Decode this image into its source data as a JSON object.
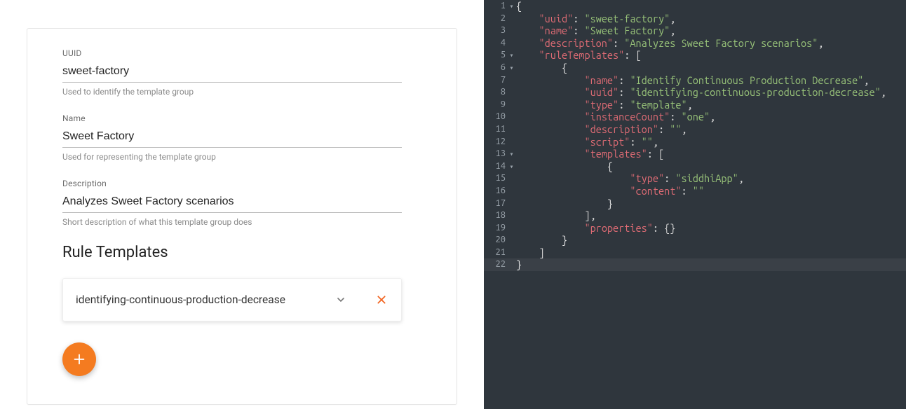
{
  "form": {
    "uuid": {
      "label": "UUID",
      "value": "sweet-factory",
      "help": "Used to identify the template group"
    },
    "name": {
      "label": "Name",
      "value": "Sweet Factory",
      "help": "Used for representing the template group"
    },
    "description": {
      "label": "Description",
      "value": "Analyzes Sweet Factory scenarios",
      "help": "Short description of what this template group does"
    }
  },
  "ruleTemplatesHeading": "Rule Templates",
  "ruleTemplates": [
    {
      "uuid": "identifying-continuous-production-decrease"
    }
  ],
  "code": {
    "lines": [
      {
        "n": 1,
        "fold": "▾",
        "tokens": [
          [
            "brace",
            "{"
          ]
        ]
      },
      {
        "n": 2,
        "fold": "",
        "indent": 4,
        "tokens": [
          [
            "key",
            "\"uuid\""
          ],
          [
            "punc",
            ": "
          ],
          [
            "str",
            "\"sweet-factory\""
          ],
          [
            "punc",
            ","
          ]
        ]
      },
      {
        "n": 3,
        "fold": "",
        "indent": 4,
        "tokens": [
          [
            "key",
            "\"name\""
          ],
          [
            "punc",
            ": "
          ],
          [
            "str",
            "\"Sweet Factory\""
          ],
          [
            "punc",
            ","
          ]
        ]
      },
      {
        "n": 4,
        "fold": "",
        "indent": 4,
        "tokens": [
          [
            "key",
            "\"description\""
          ],
          [
            "punc",
            ": "
          ],
          [
            "str",
            "\"Analyzes Sweet Factory scenarios\""
          ],
          [
            "punc",
            ","
          ]
        ]
      },
      {
        "n": 5,
        "fold": "▾",
        "indent": 4,
        "tokens": [
          [
            "key",
            "\"ruleTemplates\""
          ],
          [
            "punc",
            ": ["
          ]
        ]
      },
      {
        "n": 6,
        "fold": "▾",
        "indent": 8,
        "tokens": [
          [
            "brace",
            "{"
          ]
        ]
      },
      {
        "n": 7,
        "fold": "",
        "indent": 12,
        "tokens": [
          [
            "key",
            "\"name\""
          ],
          [
            "punc",
            ": "
          ],
          [
            "str",
            "\"Identify Continuous Production Decrease\""
          ],
          [
            "punc",
            ","
          ]
        ]
      },
      {
        "n": 8,
        "fold": "",
        "indent": 12,
        "tokens": [
          [
            "key",
            "\"uuid\""
          ],
          [
            "punc",
            ": "
          ],
          [
            "str",
            "\"identifying-continuous-production-decrease\""
          ],
          [
            "punc",
            ","
          ]
        ]
      },
      {
        "n": 9,
        "fold": "",
        "indent": 12,
        "tokens": [
          [
            "key",
            "\"type\""
          ],
          [
            "punc",
            ": "
          ],
          [
            "str",
            "\"template\""
          ],
          [
            "punc",
            ","
          ]
        ]
      },
      {
        "n": 10,
        "fold": "",
        "indent": 12,
        "tokens": [
          [
            "key",
            "\"instanceCount\""
          ],
          [
            "punc",
            ": "
          ],
          [
            "str",
            "\"one\""
          ],
          [
            "punc",
            ","
          ]
        ]
      },
      {
        "n": 11,
        "fold": "",
        "indent": 12,
        "tokens": [
          [
            "key",
            "\"description\""
          ],
          [
            "punc",
            ": "
          ],
          [
            "str",
            "\"\""
          ],
          [
            "punc",
            ","
          ]
        ]
      },
      {
        "n": 12,
        "fold": "",
        "indent": 12,
        "tokens": [
          [
            "key",
            "\"script\""
          ],
          [
            "punc",
            ": "
          ],
          [
            "str",
            "\"\""
          ],
          [
            "punc",
            ","
          ]
        ]
      },
      {
        "n": 13,
        "fold": "▾",
        "indent": 12,
        "tokens": [
          [
            "key",
            "\"templates\""
          ],
          [
            "punc",
            ": ["
          ]
        ]
      },
      {
        "n": 14,
        "fold": "▾",
        "indent": 16,
        "tokens": [
          [
            "brace",
            "{"
          ]
        ]
      },
      {
        "n": 15,
        "fold": "",
        "indent": 20,
        "tokens": [
          [
            "key",
            "\"type\""
          ],
          [
            "punc",
            ": "
          ],
          [
            "str",
            "\"siddhiApp\""
          ],
          [
            "punc",
            ","
          ]
        ]
      },
      {
        "n": 16,
        "fold": "",
        "indent": 20,
        "tokens": [
          [
            "key",
            "\"content\""
          ],
          [
            "punc",
            ": "
          ],
          [
            "str",
            "\"\""
          ]
        ]
      },
      {
        "n": 17,
        "fold": "",
        "indent": 16,
        "tokens": [
          [
            "brace",
            "}"
          ]
        ]
      },
      {
        "n": 18,
        "fold": "",
        "indent": 12,
        "tokens": [
          [
            "punc",
            "],"
          ]
        ]
      },
      {
        "n": 19,
        "fold": "",
        "indent": 12,
        "tokens": [
          [
            "key",
            "\"properties\""
          ],
          [
            "punc",
            ": {}"
          ]
        ]
      },
      {
        "n": 20,
        "fold": "",
        "indent": 8,
        "tokens": [
          [
            "brace",
            "}"
          ]
        ]
      },
      {
        "n": 21,
        "fold": "",
        "indent": 4,
        "tokens": [
          [
            "punc",
            "]"
          ]
        ]
      },
      {
        "n": 22,
        "fold": "",
        "hl": true,
        "tokens": [
          [
            "brace",
            "}"
          ]
        ]
      }
    ]
  }
}
